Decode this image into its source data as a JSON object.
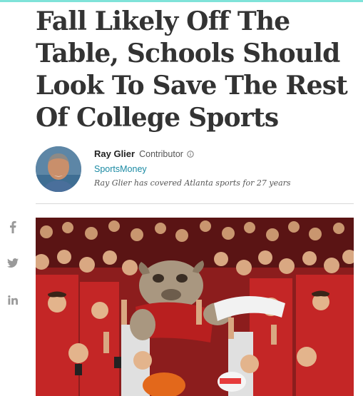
{
  "article": {
    "headline": "Fall Likely Off The Table, Schools Should Look To Save The Rest Of College Sports"
  },
  "author": {
    "name": "Ray Glier",
    "role": "Contributor",
    "channel": "SportsMoney",
    "bio": "Ray Glier has covered Atlanta sports for 27 years"
  },
  "share": {
    "items": [
      "facebook-icon",
      "twitter-icon",
      "linkedin-icon"
    ]
  },
  "colors": {
    "accent_bar": "#7fe3d9",
    "channel_link": "#1a8aa3",
    "headline_text": "#333333",
    "share_icons": "#9a9a9a"
  }
}
